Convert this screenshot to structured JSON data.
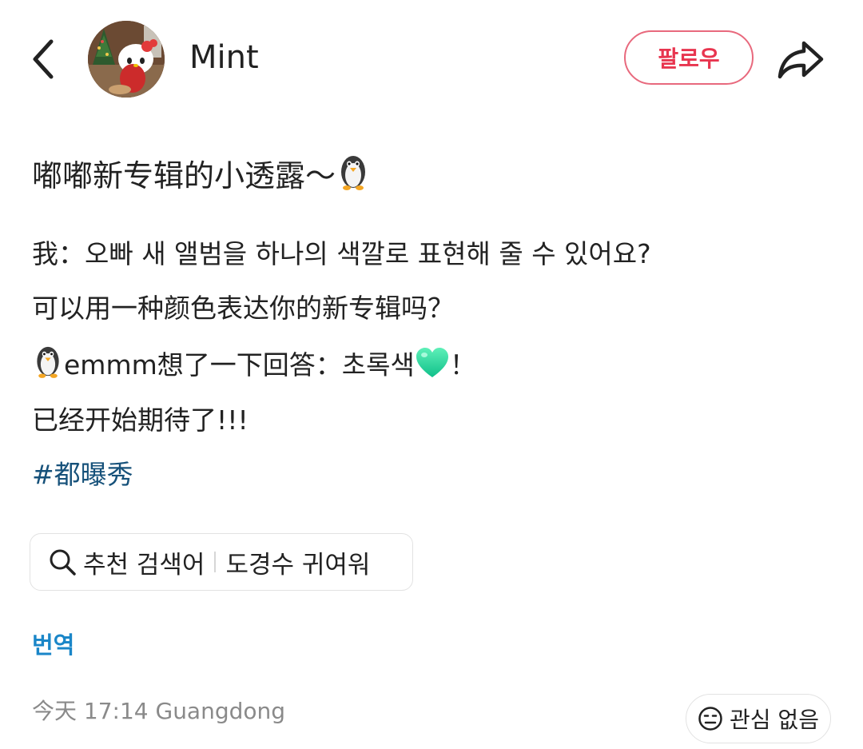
{
  "header": {
    "username": "Mint",
    "follow_label": "팔로우"
  },
  "post": {
    "title": "嘟嘟新专辑的小透露～",
    "lines": [
      "我：오빠 새 앨범을 하나의 색깔로 표현해 줄 수 있어요?",
      "可以用一种颜色表达你的新专辑吗？",
      {
        "before": "emmm想了一下回答：초록색",
        "after": "！"
      },
      "已经开始期待了!!!"
    ],
    "hashtag": "#都曝秀"
  },
  "search_chip": {
    "label": "추천 검색어",
    "query": "도경수 귀여워"
  },
  "translate_label": "번역",
  "meta": {
    "time_location": "今天 17:14 Guangdong"
  },
  "not_interested_label": "관심 없음",
  "icons": {
    "back": "chevron-left-icon",
    "share": "share-arrow-icon",
    "penguin": "penguin-emoji",
    "heart": "green-heart-emoji",
    "search": "search-icon",
    "face": "neutral-face-icon"
  },
  "colors": {
    "follow_accent": "#e8354f",
    "hashtag": "#16517a",
    "translate": "#1a86c8",
    "heart": "#22d39a"
  }
}
